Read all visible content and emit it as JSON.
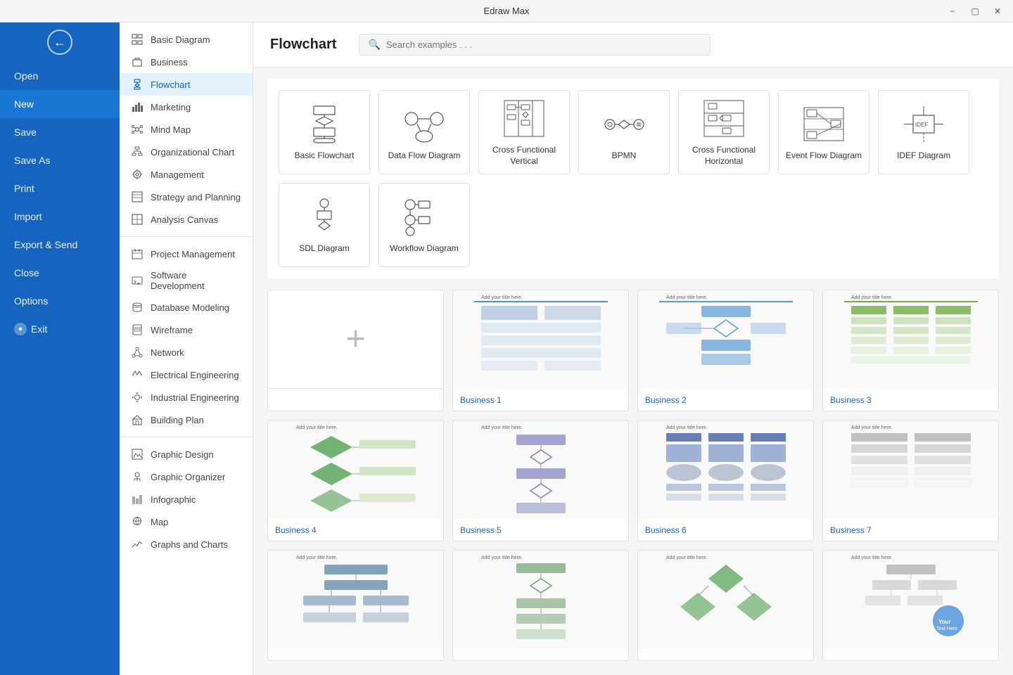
{
  "titlebar": {
    "title": "Edraw Max"
  },
  "sidebar": {
    "back_label": "←",
    "items": [
      {
        "id": "open",
        "label": "Open"
      },
      {
        "id": "new",
        "label": "New",
        "active": true
      },
      {
        "id": "save",
        "label": "Save"
      },
      {
        "id": "save-as",
        "label": "Save As"
      },
      {
        "id": "print",
        "label": "Print"
      },
      {
        "id": "import",
        "label": "Import"
      },
      {
        "id": "export",
        "label": "Export & Send"
      },
      {
        "id": "close",
        "label": "Close"
      },
      {
        "id": "options",
        "label": "Options"
      },
      {
        "id": "exit",
        "label": "Exit"
      }
    ]
  },
  "categories": {
    "main": [
      {
        "id": "basic",
        "label": "Basic Diagram",
        "icon": "⊞"
      },
      {
        "id": "business",
        "label": "Business",
        "icon": "💼"
      },
      {
        "id": "flowchart",
        "label": "Flowchart",
        "icon": "⇶",
        "active": true
      },
      {
        "id": "marketing",
        "label": "Marketing",
        "icon": "📊"
      },
      {
        "id": "mindmap",
        "label": "Mind Map",
        "icon": "🧠"
      },
      {
        "id": "orgchart",
        "label": "Organizational Chart",
        "icon": "🏢"
      },
      {
        "id": "management",
        "label": "Management",
        "icon": "⚙"
      },
      {
        "id": "strategy",
        "label": "Strategy and Planning",
        "icon": "📋"
      },
      {
        "id": "analysis",
        "label": "Analysis Canvas",
        "icon": "📰"
      }
    ],
    "tech": [
      {
        "id": "project",
        "label": "Project Management",
        "icon": "📅"
      },
      {
        "id": "software",
        "label": "Software Development",
        "icon": "💻"
      },
      {
        "id": "database",
        "label": "Database Modeling",
        "icon": "🗄"
      },
      {
        "id": "wireframe",
        "label": "Wireframe",
        "icon": "📱"
      },
      {
        "id": "network",
        "label": "Network",
        "icon": "🌐"
      },
      {
        "id": "electrical",
        "label": "Electrical Engineering",
        "icon": "⚡"
      },
      {
        "id": "industrial",
        "label": "Industrial Engineering",
        "icon": "🔧"
      },
      {
        "id": "building",
        "label": "Building Plan",
        "icon": "🏗"
      }
    ],
    "design": [
      {
        "id": "graphic-design",
        "label": "Graphic Design",
        "icon": "🎨"
      },
      {
        "id": "graphic-organizer",
        "label": "Graphic Organizer",
        "icon": "📊"
      },
      {
        "id": "infographic",
        "label": "Infographic",
        "icon": "📈"
      },
      {
        "id": "map",
        "label": "Map",
        "icon": "🗺"
      },
      {
        "id": "graphs",
        "label": "Graphs and Charts",
        "icon": "📉"
      }
    ]
  },
  "content": {
    "title": "Flowchart",
    "search_placeholder": "Search examples . . .",
    "diagram_types": [
      {
        "id": "basic-flowchart",
        "label": "Basic Flowchart"
      },
      {
        "id": "data-flow",
        "label": "Data Flow Diagram"
      },
      {
        "id": "cross-functional-v",
        "label": "Cross Functional Vertical"
      },
      {
        "id": "bpmn",
        "label": "BPMN"
      },
      {
        "id": "cross-functional-h",
        "label": "Cross Functional Horizontal"
      },
      {
        "id": "event-flow",
        "label": "Event Flow Diagram"
      },
      {
        "id": "idef",
        "label": "IDEF Diagram"
      },
      {
        "id": "sdl",
        "label": "SDL Diagram"
      },
      {
        "id": "workflow",
        "label": "Workflow Diagram"
      }
    ],
    "templates": [
      {
        "id": "new",
        "label": "",
        "is_new": true
      },
      {
        "id": "business1",
        "label": "Business 1",
        "color": "#b0c4de"
      },
      {
        "id": "business2",
        "label": "Business 2",
        "color": "#a8c8e8"
      },
      {
        "id": "business3",
        "label": "Business 3",
        "color": "#90c090"
      },
      {
        "id": "business4",
        "label": "Business 4",
        "color": "#50a050"
      },
      {
        "id": "business5",
        "label": "Business 5",
        "color": "#8080c0"
      },
      {
        "id": "business6",
        "label": "Business 6",
        "color": "#4060a0"
      },
      {
        "id": "business7",
        "label": "Business 7",
        "color": "#aaaaaa"
      },
      {
        "id": "business8",
        "label": "",
        "color": "#5080a0"
      },
      {
        "id": "business9",
        "label": "",
        "color": "#70a070"
      },
      {
        "id": "business10",
        "label": "",
        "color": "#50a050"
      },
      {
        "id": "business11",
        "label": "",
        "color": "#aaaaaa"
      }
    ]
  }
}
